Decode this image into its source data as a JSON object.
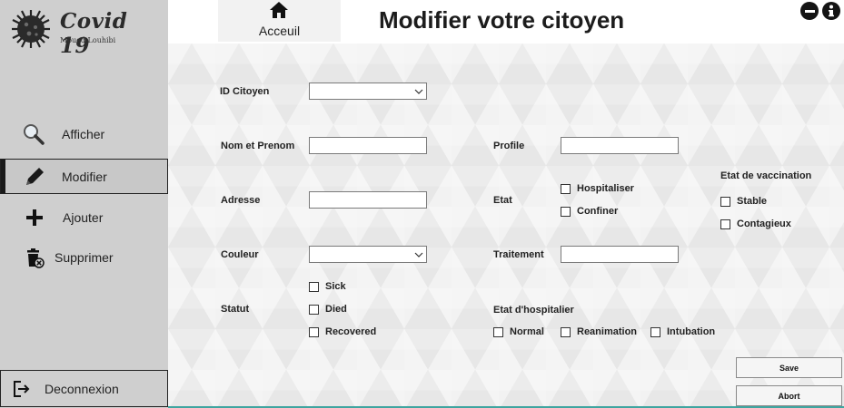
{
  "app": {
    "logo_title": "Covid 19",
    "logo_subtitle": "Moued Louhibi"
  },
  "header": {
    "home_label": "Acceuil",
    "page_title": "Modifier votre citoyen"
  },
  "sidebar": {
    "items": [
      {
        "label": "Afficher",
        "icon": "magnifier-icon"
      },
      {
        "label": "Modifier",
        "icon": "pen-icon",
        "active": true
      },
      {
        "label": "Ajouter",
        "icon": "plus-icon"
      },
      {
        "label": "Supprimer",
        "icon": "trash-icon"
      }
    ],
    "logout_label": "Deconnexion"
  },
  "form": {
    "id_label": "ID Citoyen",
    "name_label": "Nom et Prenom",
    "address_label": "Adresse",
    "color_label": "Couleur",
    "status_label": "Statut",
    "status_options": [
      "Sick",
      "Died",
      "Recovered"
    ],
    "profile_label": "Profile",
    "state_label": "Etat",
    "state_options": [
      "Hospitaliser",
      "Confiner"
    ],
    "treatment_label": "Traitement",
    "hosp_state_label": "Etat d'hospitalier",
    "hosp_state_options": [
      "Normal",
      "Reanimation",
      "Intubation"
    ],
    "vaccination_label": "Etat de vaccination",
    "vaccination_options": [
      "Stable",
      "Contagieux"
    ]
  },
  "actions": {
    "save_label": "Save",
    "abort_label": "Abort"
  },
  "colors": {
    "sidebar_bg": "#cfcfcf",
    "accent_line": "#3fa5a0"
  }
}
